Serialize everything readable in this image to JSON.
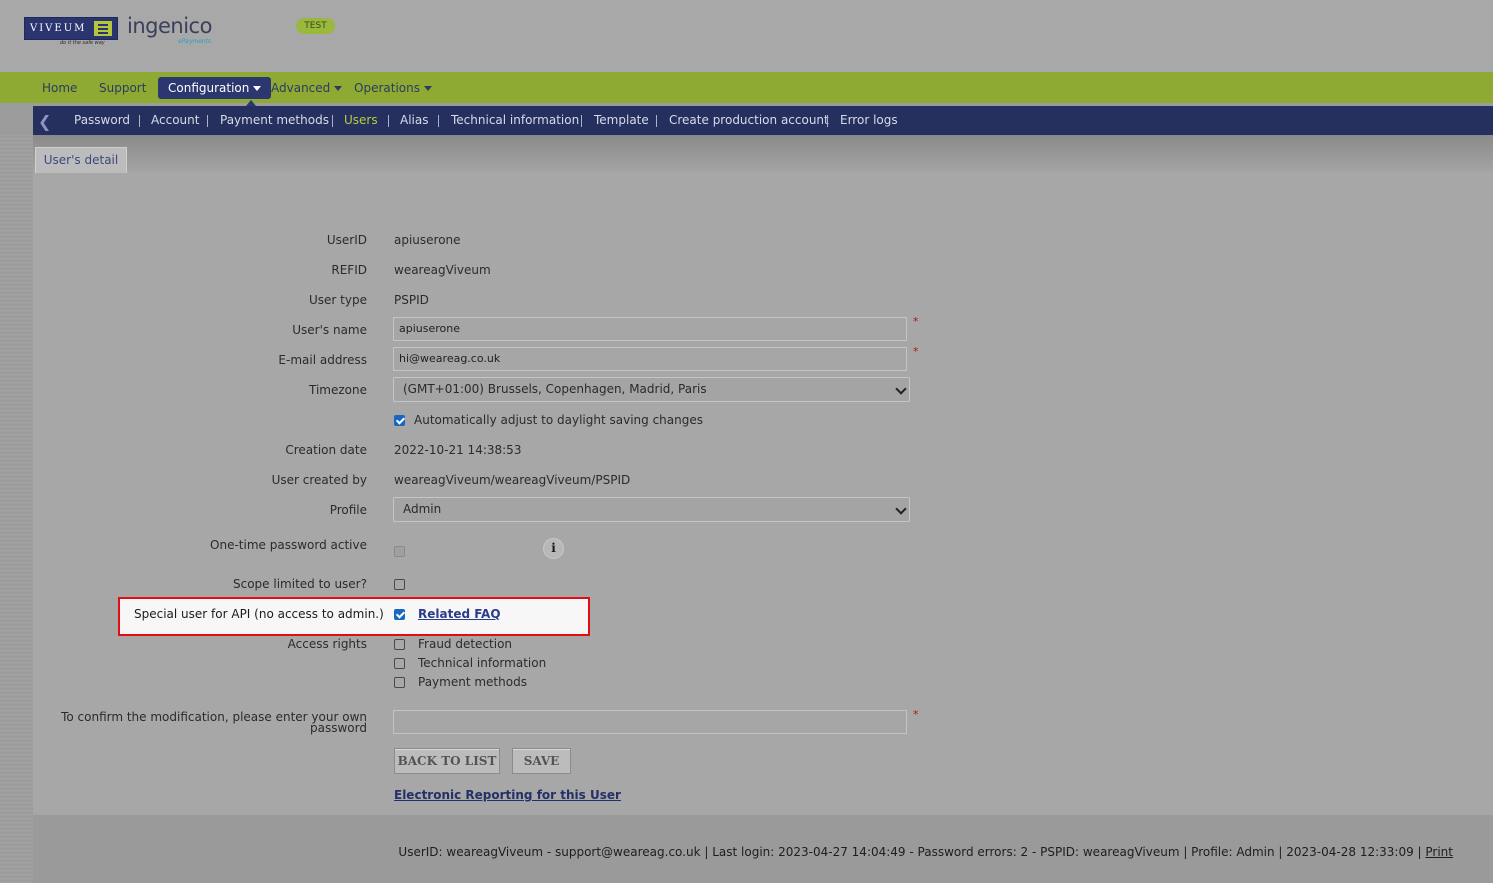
{
  "header": {
    "logo_viveum": "VIVEUM",
    "logo_tagline": "do it the safe way",
    "logo_ingenico": "ingenico",
    "logo_epayments": "ePayments",
    "env_badge": "TEST"
  },
  "mainnav": {
    "items": [
      "Home",
      "Support",
      "Configuration",
      "Advanced",
      "Operations"
    ]
  },
  "subnav": {
    "items": [
      "Password",
      "Account",
      "Payment methods",
      "Users",
      "Alias",
      "Technical information",
      "Template",
      "Create production account",
      "Error logs"
    ],
    "current": "Users"
  },
  "tab": {
    "label": "User's detail"
  },
  "form": {
    "userid_label": "UserID",
    "userid_value": "apiuserone",
    "refid_label": "REFID",
    "refid_value": "weareagViveum",
    "usertype_label": "User type",
    "usertype_value": "PSPID",
    "username_label": "User's name",
    "username_value": "apiuserone",
    "email_label": "E-mail address",
    "email_value": "hi@weareag.co.uk",
    "timezone_label": "Timezone",
    "timezone_value": "(GMT+01:00) Brussels, Copenhagen, Madrid, Paris",
    "dst_label": "Automatically adjust to daylight saving changes",
    "creation_label": "Creation date",
    "creation_value": "2022-10-21 14:38:53",
    "createdby_label": "User created by",
    "createdby_value": "weareagViveum/weareagViveum/PSPID",
    "profile_label": "Profile",
    "profile_value": "Admin",
    "otp_label": "One-time password active",
    "info_icon": "i",
    "scope_label": "Scope limited to user?",
    "special_label": "Special user for API (no access to admin.)",
    "faq_link": "Related FAQ",
    "access_label": "Access rights",
    "access_rights": [
      "Fraud detection",
      "Technical information",
      "Payment methods"
    ],
    "confirm_label_line1": "To confirm the modification, please enter your own",
    "confirm_label_line2": "password",
    "required_mark": "*"
  },
  "buttons": {
    "back": "BACK TO LIST",
    "save": "SAVE"
  },
  "report_link": "Electronic Reporting for this User",
  "footer": {
    "text": "UserID: weareagViveum - support@weareag.co.uk | Last login: 2023-04-27 14:04:49 - Password errors: 2 - PSPID: weareagViveum | Profile: Admin | 2023-04-28 12:33:09 | ",
    "print_link": "Print"
  },
  "colors": {
    "highlight_border": "#e10d12",
    "nav_green": "#8eaa32",
    "nav_blue": "#25305f",
    "checkbox_checked": "#1668c4"
  }
}
